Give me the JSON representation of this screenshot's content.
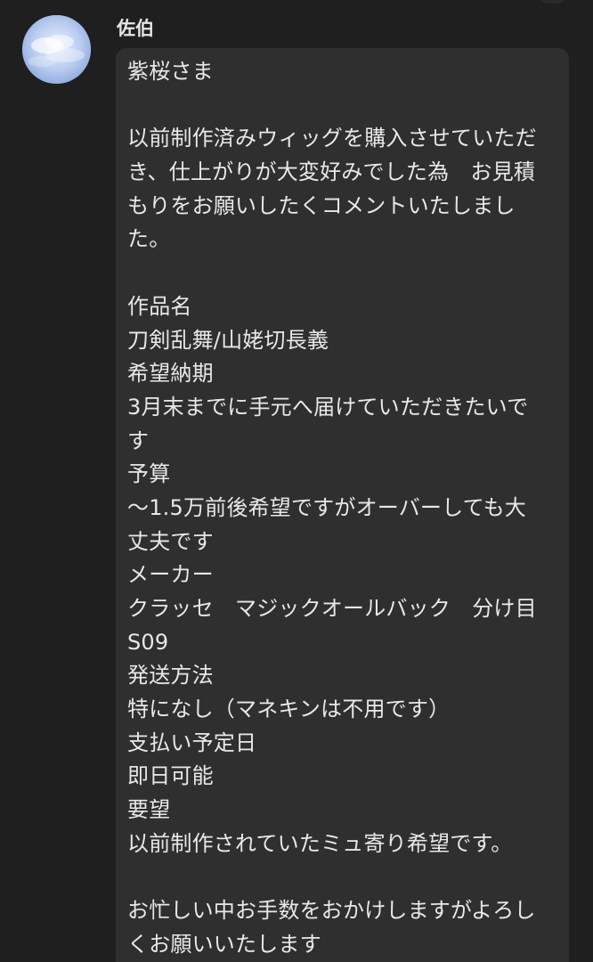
{
  "message": {
    "sender": "佐伯",
    "avatar": "cloud-sky-avatar",
    "lines": [
      "紫桜さま",
      "",
      "以前制作済みウィッグを購入させていただ",
      "き、仕上がりが大変好みでした為　お見積",
      "もりをお願いしたくコメントいたしまし",
      "た。",
      "",
      "作品名",
      "刀剣乱舞/山姥切長義",
      "希望納期",
      "3月末までに手元へ届けていただきたいで",
      "す",
      "予算",
      "〜1.5万前後希望ですがオーバーしても大",
      "丈夫です",
      "メーカー",
      "クラッセ　マジックオールバック　分け目",
      "S09",
      "発送方法",
      "特になし（マネキンは不用です）",
      "支払い予定日",
      "即日可能",
      "要望",
      "以前制作されていたミュ寄り希望です。",
      "",
      "お忙しい中お手数をおかけしますがよろし",
      "くお願いいたします"
    ]
  },
  "colors": {
    "background": "#1f1f1f",
    "bubble": "#2f2f2f",
    "text": "#e8e8e8",
    "avatar_sky": "#a9bfe6"
  }
}
